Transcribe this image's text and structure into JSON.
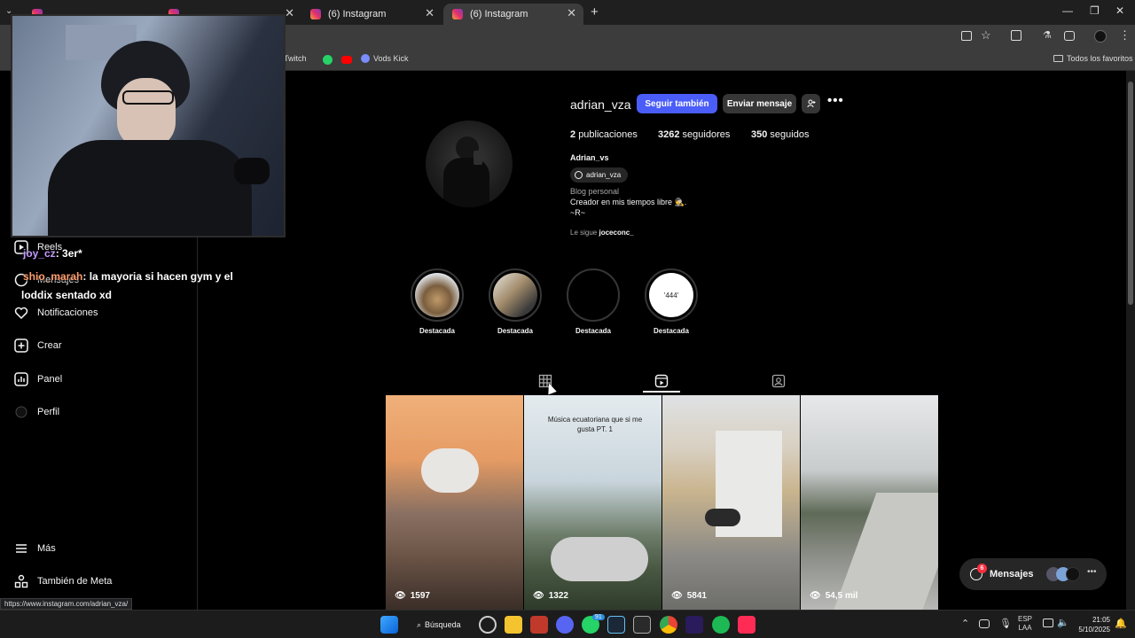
{
  "browser": {
    "tabs": [
      {
        "label": "(6) Instagram"
      },
      {
        "label": "(6) Instagram"
      }
    ],
    "new_tab": "+",
    "bookmarks": [
      {
        "label": "Twitch"
      },
      {
        "label": "Vods Kick"
      }
    ],
    "all_bookmarks": "Todos los favoritos",
    "status_url": "https://www.instagram.com/adrian_vza/"
  },
  "sidebar": {
    "items": [
      {
        "label": "Reels"
      },
      {
        "label": "Mensajes"
      },
      {
        "label": "Notificaciones"
      },
      {
        "label": "Crear"
      },
      {
        "label": "Panel"
      },
      {
        "label": "Perfil"
      },
      {
        "label": "Más"
      },
      {
        "label": "También de Meta"
      }
    ]
  },
  "chat": {
    "messages": [
      {
        "user": "joy_cz",
        "text": ": 3er*"
      },
      {
        "user": "shio_marah",
        "text": ": la mayoria si hacen gym y el"
      },
      {
        "user": "",
        "text": "loddix sentado xd"
      }
    ]
  },
  "profile": {
    "username": "adrian_vza",
    "follow_button": "Seguir también",
    "message_button": "Enviar mensaje",
    "posts_count": "2",
    "posts_label": "publicaciones",
    "followers_count": "3262",
    "followers_label": "seguidores",
    "following_count": "350",
    "following_label": "seguidos",
    "name": "Adrian_vs",
    "threads_handle": "adrian_vza",
    "category": "Blog personal",
    "bio_line1": "Creador en mis tiempos libre 🕵️.",
    "bio_line2": "~R~",
    "followed_by_prefix": "Le sigue",
    "followed_by_user": "joceconc_"
  },
  "highlights": [
    {
      "label": "Destacada",
      "text": ""
    },
    {
      "label": "Destacada",
      "text": ""
    },
    {
      "label": "Destacada",
      "text": ""
    },
    {
      "label": "Destacada",
      "text": "'444'"
    }
  ],
  "tabs": [
    {
      "icon": "grid-icon"
    },
    {
      "icon": "reels-icon"
    },
    {
      "icon": "tagged-icon"
    }
  ],
  "reels": [
    {
      "views": "1597",
      "caption": ""
    },
    {
      "views": "1322",
      "caption": "Música ecuatoriana que si me gusta PT. 1"
    },
    {
      "views": "5841",
      "caption": ""
    },
    {
      "views": "54,5 mil",
      "caption": ""
    }
  ],
  "messages_widget": {
    "label": "Mensajes",
    "badge": "6"
  },
  "taskbar": {
    "search": "Búsqueda",
    "lang_line1": "ESP",
    "lang_line2": "LAA",
    "time": "21:05",
    "date": "5/10/2025",
    "steam_badge": "91"
  },
  "colors": {
    "accent": "#4a5df9",
    "secondary_button": "#363636",
    "page_bg": "#000000",
    "chat_user1": "#c59cff",
    "chat_user2": "#ff9c6b"
  }
}
